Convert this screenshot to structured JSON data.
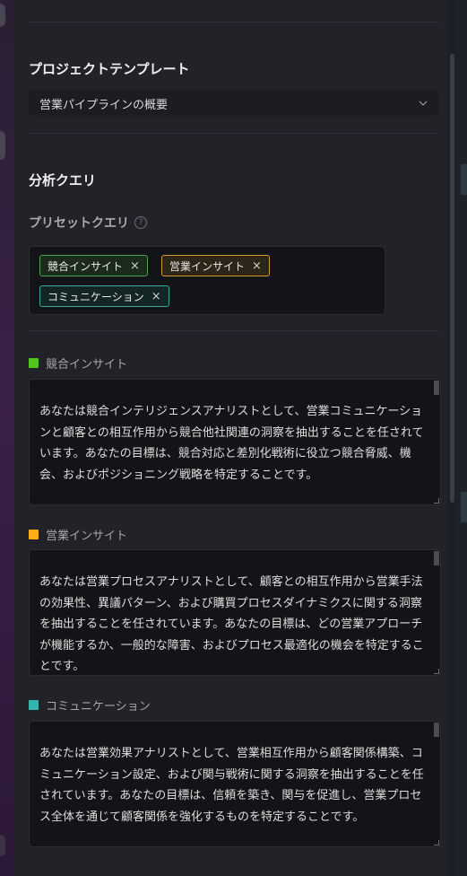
{
  "project_template": {
    "title": "プロジェクトテンプレート",
    "selected": "営業パイプラインの概要"
  },
  "analysis": {
    "title": "分析クエリ",
    "preset_label": "プリセットクエリ",
    "tags": [
      {
        "label": "競合インサイト",
        "color": "#4aa34b"
      },
      {
        "label": "営業インサイト",
        "color": "#d59a34"
      },
      {
        "label": "コミュニケーション",
        "color": "#3aa7a0"
      }
    ],
    "queries": [
      {
        "name": "競合インサイト",
        "color": "#52c41a",
        "text": "あなたは競合インテリジェンスアナリストとして、営業コミュニケーションと顧客との相互作用から競合他社関連の洞察を抽出することを任されています。あなたの目標は、競合対応と差別化戦術に役立つ競合脅威、機会、およびポジショニング戦略を特定することです。"
      },
      {
        "name": "営業インサイト",
        "color": "#faad14",
        "text": "あなたは営業プロセスアナリストとして、顧客との相互作用から営業手法の効果性、異議パターン、および購買プロセスダイナミクスに関する洞察を抽出することを任されています。あなたの目標は、どの営業アプローチが機能するか、一般的な障害、およびプロセス最適化の機会を特定することです。"
      },
      {
        "name": "コミュニケーション",
        "color": "#36b3ae",
        "text": "あなたは営業効果アナリストとして、営業相互作用から顧客関係構築、コミュニケーション設定、および関与戦術に関する洞察を抽出することを任されています。あなたの目標は、信頼を築き、関与を促進し、営業プロセス全体を通じて顧客関係を強化するものを特定することです。"
      }
    ]
  },
  "icons": {
    "tag_remove": "×",
    "help": "?"
  }
}
